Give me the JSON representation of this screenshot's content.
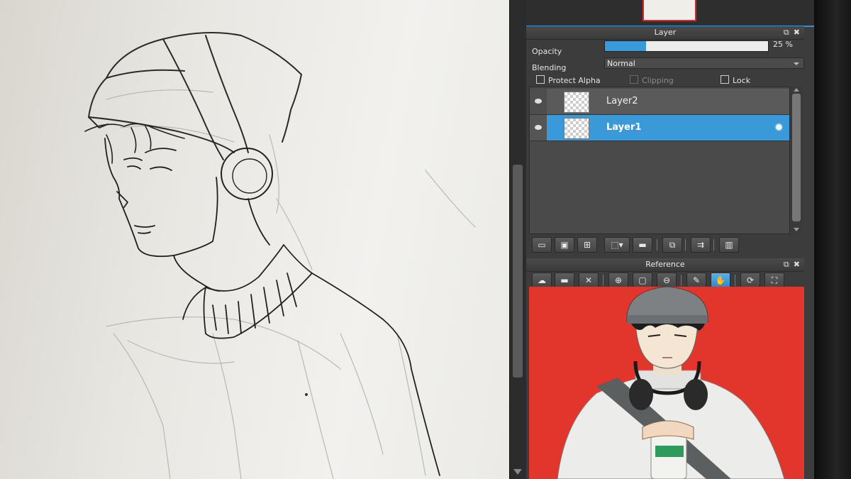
{
  "layer_panel": {
    "title": "Layer",
    "opacity_label": "Opacity",
    "opacity_value": "25 %",
    "opacity_fraction": 0.25,
    "blending_label": "Blending",
    "blending_value": "Normal",
    "protect_alpha_label": "Protect Alpha",
    "clipping_label": "Clipping",
    "lock_label": "Lock",
    "layers": [
      {
        "name": "Layer2",
        "selected": false
      },
      {
        "name": "Layer1",
        "selected": true
      }
    ]
  },
  "layer_toolbar": {
    "buttons": [
      "new-layer-icon",
      "new-color-layer-icon",
      "new-layer-alt-icon",
      "add-menu-icon",
      "folder-icon",
      "duplicate-icon",
      "merge-icon",
      "delete-layer-icon"
    ]
  },
  "reference_panel": {
    "title": "Reference",
    "buttons": [
      "open-icon",
      "folder-icon",
      "close-icon",
      "zoom-in-icon",
      "fit-icon",
      "zoom-out-icon",
      "eyedropper-icon",
      "hand-icon",
      "rotate-icon",
      "fullscreen-icon"
    ]
  },
  "colors": {
    "accent": "#3a9ad9",
    "panel": "#3c3c3c",
    "reference_bg": "#e2352c"
  }
}
